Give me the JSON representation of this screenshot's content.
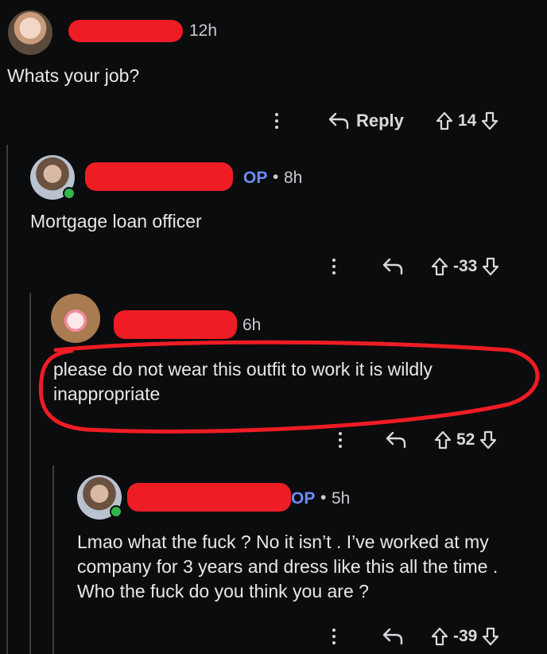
{
  "comments": [
    {
      "time": "12h",
      "text": "Whats your job?",
      "actions": {
        "reply_label": "Reply",
        "score": "14"
      }
    },
    {
      "op_label": "OP",
      "sep": "•",
      "time": "8h",
      "text": "Mortgage loan officer",
      "actions": {
        "score": "-33"
      }
    },
    {
      "time": "6h",
      "text": "please do not wear this outfit to work it is wildly inappropriate",
      "actions": {
        "score": "52"
      }
    },
    {
      "op_label": "OP",
      "sep": "•",
      "time": "5h",
      "text": "Lmao what the fuck ? No it isn’t . I’ve worked at my company for 3 years and dress like this all the time . Who the fuck do you think you are ?",
      "actions": {
        "score": "-39"
      }
    }
  ],
  "colors": {
    "background": "#0b0c0e",
    "op_accent": "#6d8cf5",
    "redaction": "#ee1c24",
    "online": "#32b54a"
  },
  "icons": [
    "kebab-menu-icon",
    "reply-arrow-icon",
    "upvote-icon",
    "downvote-icon"
  ]
}
